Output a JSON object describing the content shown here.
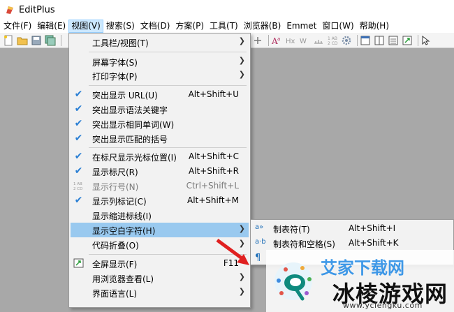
{
  "window": {
    "title": "EditPlus"
  },
  "menubar": [
    "文件(F)",
    "编辑(E)",
    "视图(V)",
    "搜索(S)",
    "文档(D)",
    "方案(P)",
    "工具(T)",
    "浏览器(B)",
    "Emmet",
    "窗口(W)",
    "帮助(H)"
  ],
  "view_menu": {
    "toolbar_view": "工具栏/视图(T)",
    "screen_font": "屏幕字体(S)",
    "print_font": "打印字体(P)",
    "highlight_url": {
      "label": "突出显示 URL(U)",
      "shortcut": "Alt+Shift+U"
    },
    "highlight_keywords": "突出显示语法关键字",
    "highlight_same_word": "突出显示相同单词(W)",
    "highlight_brackets": "突出显示匹配的括号",
    "ruler_cursor": {
      "label": "在标尺显示光标位置(I)",
      "shortcut": "Alt+Shift+C"
    },
    "show_ruler": {
      "label": "显示标尺(R)",
      "shortcut": "Alt+Shift+R"
    },
    "line_numbers": {
      "label": "显示行号(N)",
      "shortcut": "Ctrl+Shift+L"
    },
    "column_marker": {
      "label": "显示列标记(C)",
      "shortcut": "Alt+Shift+M"
    },
    "indent_guides": "显示缩进标线(I)",
    "whitespace": "显示空白字符(H)",
    "code_folding": "代码折叠(O)",
    "fullscreen": {
      "label": "全屏显示(F)",
      "shortcut": "F11"
    },
    "browser_view": "用浏览器查看(L)",
    "ui_language": "界面语言(L)"
  },
  "whitespace_submenu": {
    "tabs": {
      "label": "制表符(T)",
      "shortcut": "Alt+Shift+I",
      "icon": "a»"
    },
    "tabs_spaces": {
      "label": "制表符和空格(S)",
      "shortcut": "Alt+Shift+K",
      "icon": "a·b"
    }
  },
  "watermark": {
    "title": "冰棱游戏网",
    "url": "www.yclengku.com",
    "top_text": "艾家下载网"
  },
  "colors": {
    "highlight": "#99c9ef",
    "check": "#2a7fd4",
    "menu_active": "#cce8ff",
    "arrow_red": "#e02020"
  }
}
